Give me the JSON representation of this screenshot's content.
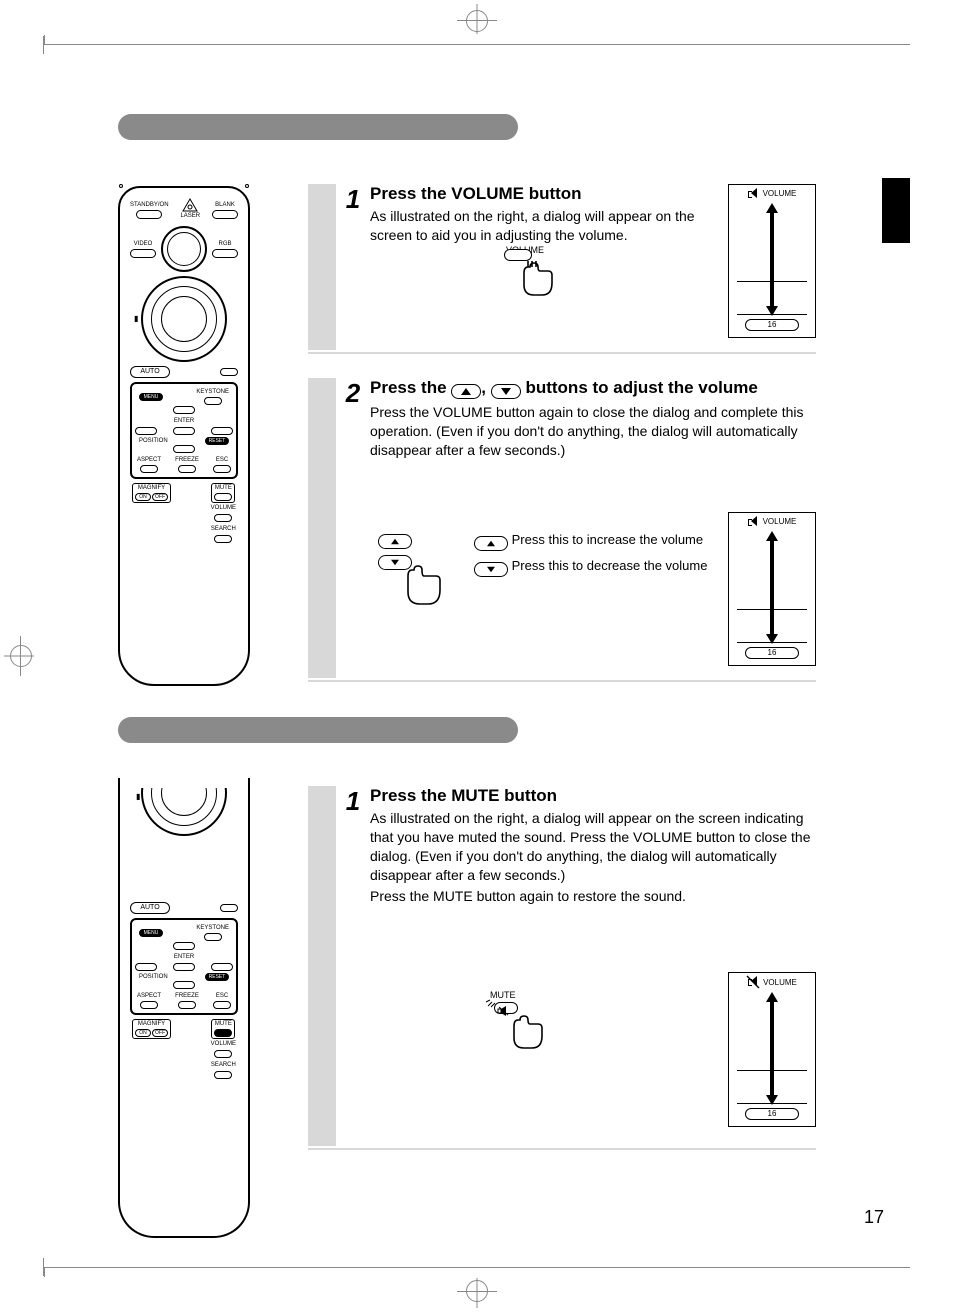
{
  "page_number": "17",
  "section1": {
    "step1": {
      "num": "1",
      "title": "Press the VOLUME button",
      "body": "As illustrated on the right, a dialog will appear on the screen to aid you in adjusting the volume.",
      "hand_label": "VOLUME"
    },
    "step2": {
      "num": "2",
      "title_pre": "Press the ",
      "title_mid": ", ",
      "title_post": " buttons to adjust the volume",
      "body": "Press the VOLUME button again to close the dialog and complete this operation.  (Even if you don't do anything, the dialog will automatically disappear after a few seconds.)",
      "inc_label": "Press this to increase the volume",
      "dec_label": "Press this to decrease the volume"
    }
  },
  "section2": {
    "step1": {
      "num": "1",
      "title": "Press the MUTE button",
      "body1": "As illustrated on the right, a dialog will appear on the screen indicating that you have muted the sound.  Press the VOLUME button to close the dialog.  (Even if you don't do anything, the dialog will automatically disappear after a few seconds.)",
      "body2": "Press the MUTE button again to restore the sound.",
      "hand_label": "MUTE"
    }
  },
  "volume_panel": {
    "label": "VOLUME",
    "value": "16"
  },
  "remote": {
    "standby": "STANDBY/ON",
    "blank": "BLANK",
    "laser": "LASER",
    "video": "VIDEO",
    "rgb": "RGB",
    "auto": "AUTO",
    "menu": "MENU",
    "keystone": "KEYSTONE",
    "enter": "ENTER",
    "position": "POSITION",
    "reset": "RESET",
    "aspect": "ASPECT",
    "freeze": "FREEZE",
    "esc": "ESC",
    "magnify": "MAGNIFY",
    "on": "ON",
    "off": "OFF",
    "mute": "MUTE",
    "volume": "VOLUME",
    "search": "SEARCH"
  }
}
